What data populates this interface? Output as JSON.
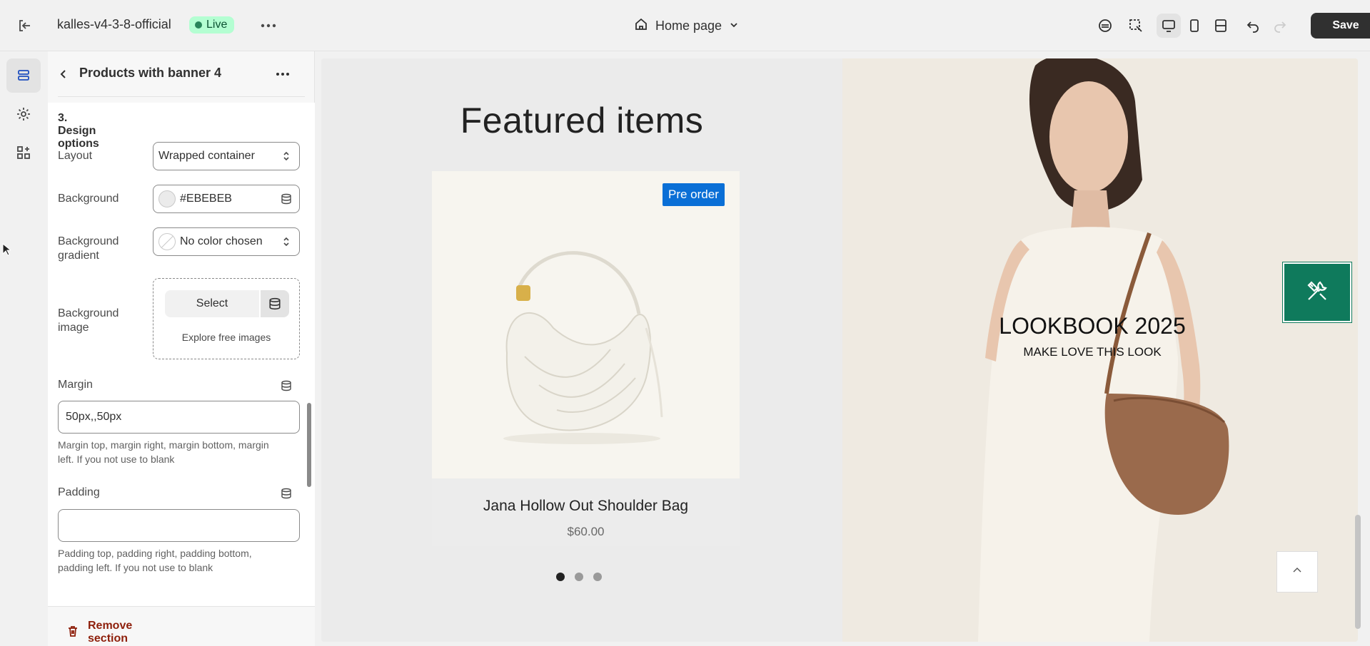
{
  "topbar": {
    "store_name": "kalles-v4-3-8-official",
    "status_badge": "Live",
    "page_select": "Home page",
    "save_label": "Save"
  },
  "panel": {
    "title": "Products with banner 4",
    "section_title": "3. Design options",
    "layout": {
      "label": "Layout",
      "value": "Wrapped container"
    },
    "background": {
      "label": "Background",
      "value": "#EBEBEB",
      "color": "#EBEBEB"
    },
    "background_gradient": {
      "label": "Background gradient",
      "value": "No color chosen"
    },
    "background_image": {
      "label": "Background image",
      "select_label": "Select",
      "explore_label": "Explore free images"
    },
    "margin": {
      "label": "Margin",
      "value": "50px,,50px",
      "help": "Margin top, margin right, margin bottom, margin left. If you not use to blank"
    },
    "padding": {
      "label": "Padding",
      "value": "",
      "help": "Padding top, padding right, padding bottom, padding left. If you not use to blank"
    },
    "remove_label": "Remove section"
  },
  "preview": {
    "featured_title": "Featured items",
    "product": {
      "badge": "Pre order",
      "name": "Jana Hollow Out Shoulder Bag",
      "price": "$60.00"
    },
    "banner": {
      "title": "LOOKBOOK 2025",
      "subtitle": "MAKE LOVE THIS LOOK"
    }
  },
  "colors": {
    "accent_green": "#0F7A5C",
    "badge_blue": "#0A6FD6",
    "danger": "#8E1F0B",
    "live_bg": "#B4FED2"
  }
}
